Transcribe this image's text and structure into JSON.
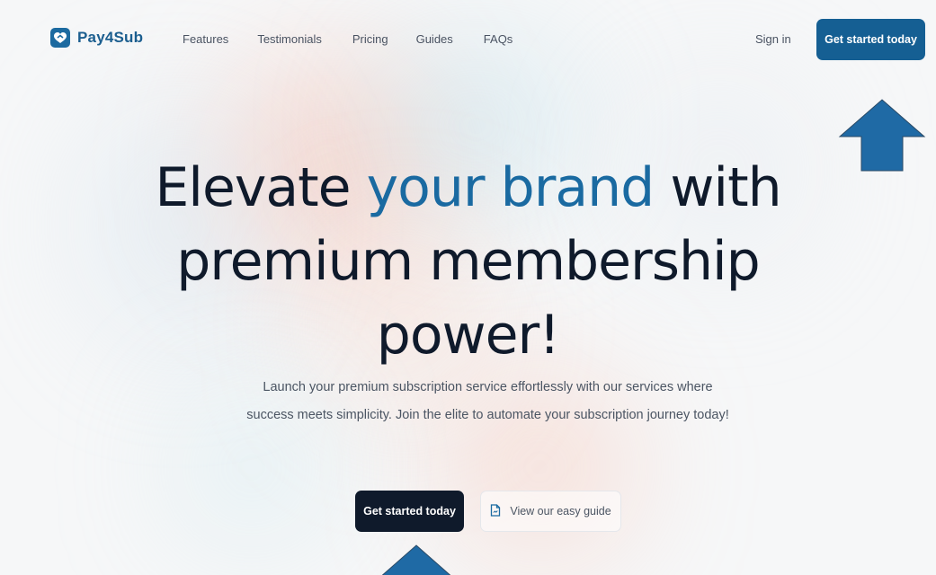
{
  "brand": {
    "name": "Pay4Sub",
    "logo_icon": "heart-logo-icon",
    "color": "#1b5e8f"
  },
  "nav": {
    "links": [
      "Features",
      "Testimonials",
      "Pricing",
      "Guides",
      "FAQs"
    ],
    "sign_in": "Sign in",
    "cta": "Get started today"
  },
  "hero": {
    "headline_part1": "Elevate ",
    "headline_accent": "your brand",
    "headline_part2": " with",
    "headline_line2": "premium membership",
    "headline_line3": "power!",
    "subtext": "Launch your premium subscription service effortlessly with our services where success meets simplicity. Join the elite to automate your subscription journey today!",
    "primary_cta": "Get started today",
    "secondary_cta": "View our easy guide",
    "secondary_icon": "document-icon"
  },
  "colors": {
    "accent": "#1a6aa1",
    "dark": "#0f1a2b",
    "annotation_arrow": "#1f6aa5"
  }
}
